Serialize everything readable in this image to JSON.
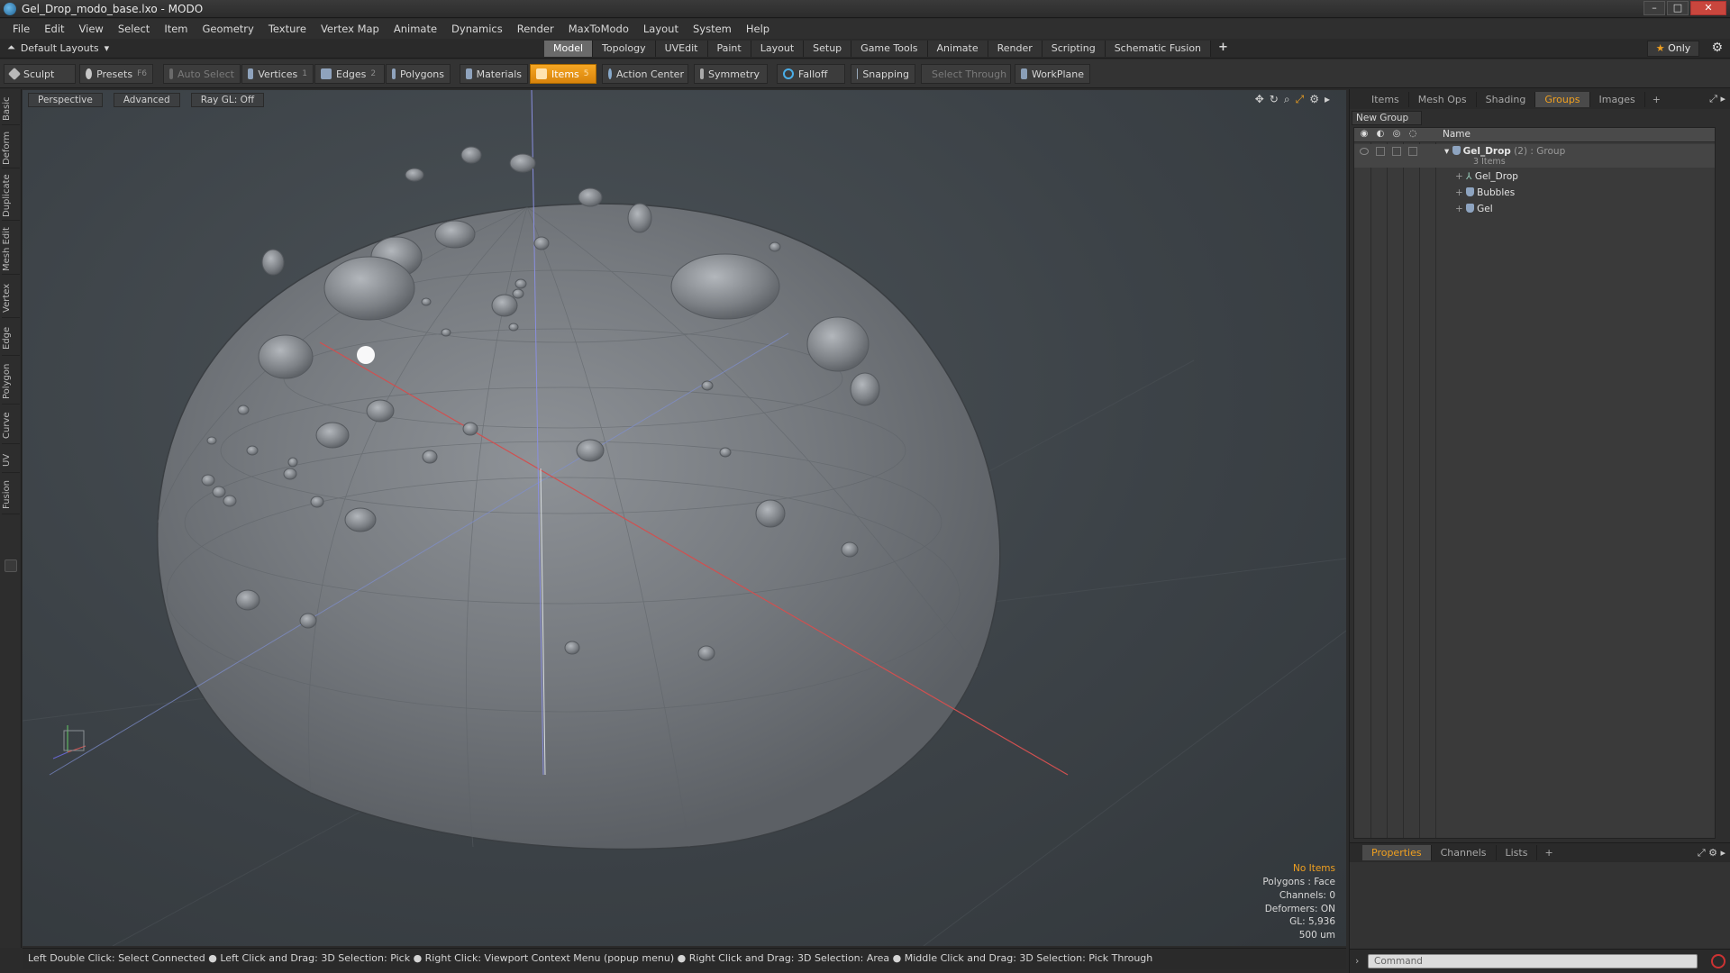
{
  "window": {
    "title": "Gel_Drop_modo_base.lxo - MODO"
  },
  "menu": [
    "File",
    "Edit",
    "View",
    "Select",
    "Item",
    "Geometry",
    "Texture",
    "Vertex Map",
    "Animate",
    "Dynamics",
    "Render",
    "MaxToModo",
    "Layout",
    "System",
    "Help"
  ],
  "layout_bar": {
    "layouts_label": "Default Layouts",
    "tabs": [
      "Model",
      "Topology",
      "UVEdit",
      "Paint",
      "Layout",
      "Setup",
      "Game Tools",
      "Animate",
      "Render",
      "Scripting",
      "Schematic Fusion"
    ],
    "active_tab": "Model",
    "only_label": "Only"
  },
  "toolbar": {
    "sculpt": "Sculpt",
    "presets": "Presets",
    "presets_key": "F6",
    "auto_select": "Auto Select",
    "vertices": "Vertices",
    "vertices_key": "1",
    "edges": "Edges",
    "edges_key": "2",
    "polygons": "Polygons",
    "materials": "Materials",
    "items": "Items",
    "items_key": "5",
    "action_center": "Action Center",
    "symmetry": "Symmetry",
    "falloff": "Falloff",
    "snapping": "Snapping",
    "select_through": "Select Through",
    "workplane": "WorkPlane"
  },
  "left_tabs": [
    "Basic",
    "Deform",
    "Duplicate",
    "Mesh Edit",
    "Vertex",
    "Edge",
    "Polygon",
    "Curve",
    "UV",
    "Fusion"
  ],
  "viewport": {
    "view": "Perspective",
    "shading": "Advanced",
    "raygl": "Ray GL: Off",
    "info": {
      "selection": "No Items",
      "polygons": "Polygons : Face",
      "channels": "Channels: 0",
      "deformers": "Deformers: ON",
      "gl": "GL: 5,936",
      "scale": "500 um"
    }
  },
  "statusbar": "Left Double Click: Select Connected ● Left Click and Drag: 3D Selection: Pick ● Right Click: Viewport Context Menu (popup menu) ● Right Click and Drag: 3D Selection: Area ● Middle Click and Drag: 3D Selection: Pick Through",
  "right_panel": {
    "tabs": [
      "Items",
      "Mesh Ops",
      "Shading",
      "Groups",
      "Images"
    ],
    "active_tab": "Groups",
    "new_group": "New Group",
    "name_header": "Name",
    "group": {
      "name": "Gel_Drop",
      "count": "(2)",
      "type": ": Group",
      "items_count": "3 Items"
    },
    "children": [
      "Gel_Drop",
      "Bubbles",
      "Gel"
    ]
  },
  "props_panel": {
    "tabs": [
      "Properties",
      "Channels",
      "Lists"
    ],
    "active_tab": "Properties",
    "command_placeholder": "Command"
  },
  "colors": {
    "accent": "#f0a020",
    "viewport_bg": "#3c4247"
  }
}
